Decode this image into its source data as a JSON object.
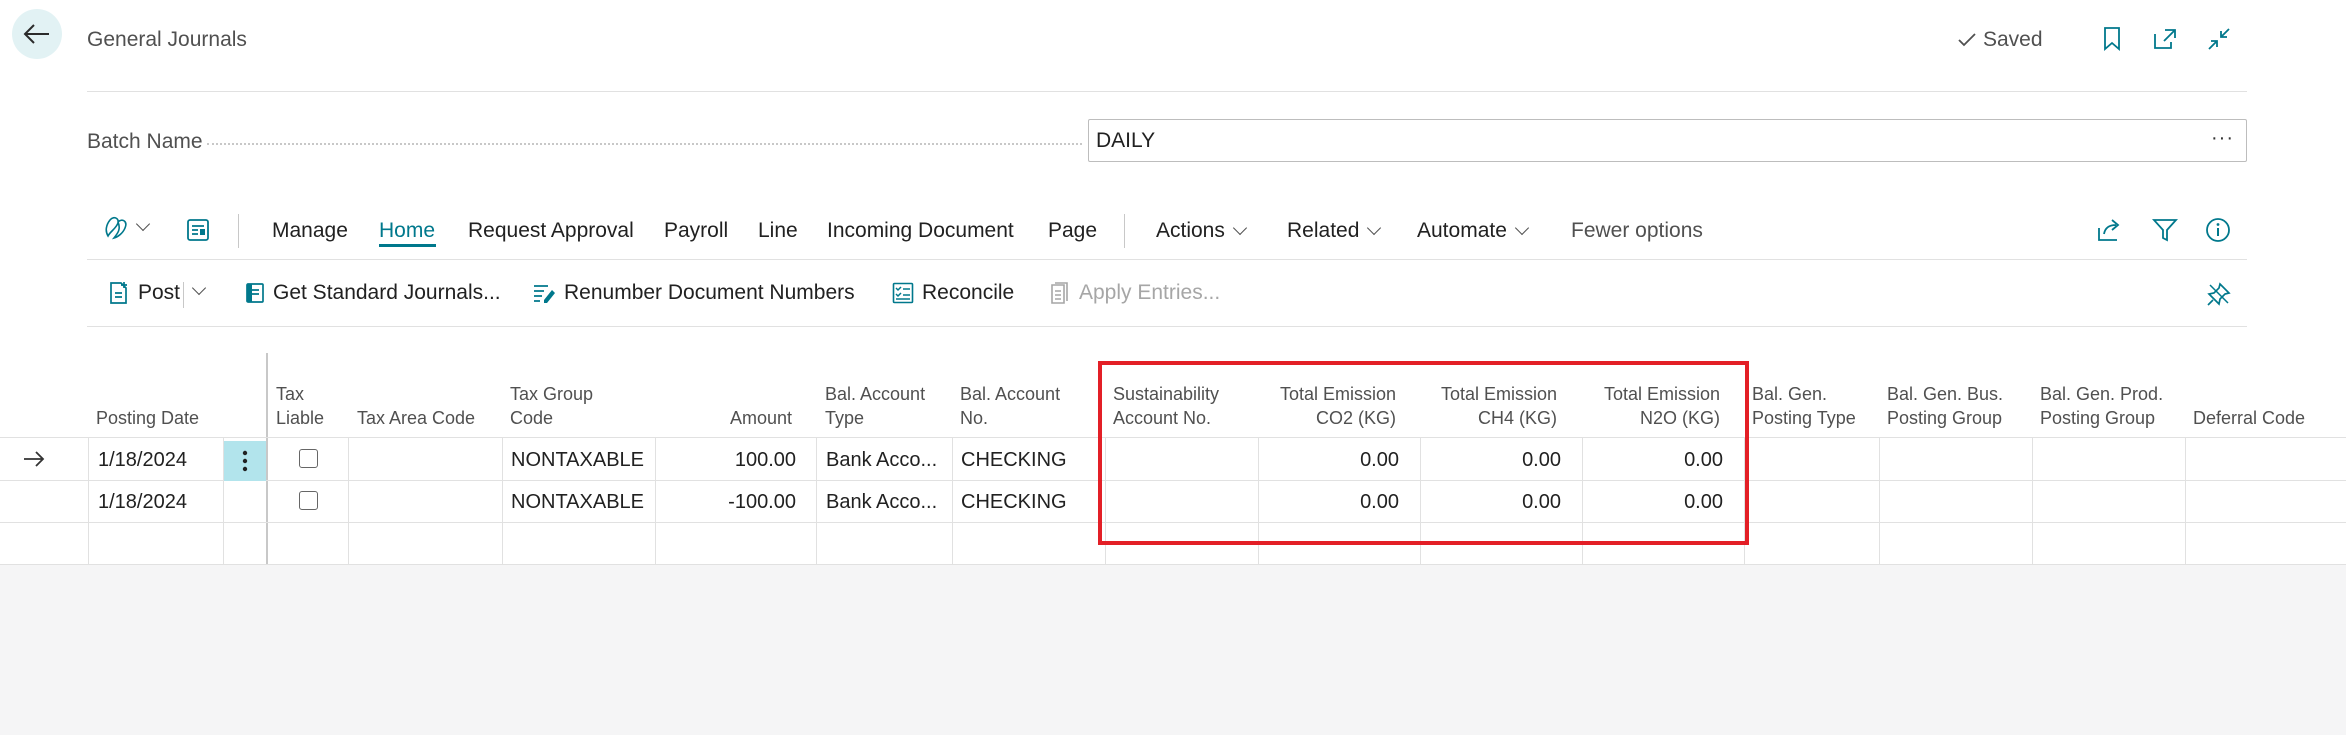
{
  "header": {
    "title": "General Journals",
    "saved_label": "Saved"
  },
  "batch": {
    "label": "Batch Name",
    "value": "DAILY"
  },
  "menu": {
    "items": [
      "Manage",
      "Home",
      "Request Approval",
      "Payroll",
      "Line",
      "Incoming Document",
      "Page"
    ],
    "active": "Home",
    "dropdowns": [
      "Actions",
      "Related",
      "Automate"
    ],
    "fewer_options": "Fewer options"
  },
  "commands": {
    "post": "Post",
    "get_standard": "Get Standard Journals...",
    "renumber": "Renumber Document Numbers",
    "reconcile": "Reconcile",
    "apply_entries": "Apply Entries..."
  },
  "table": {
    "columns": [
      {
        "line1": "",
        "line2": "Posting Date"
      },
      {
        "line1": "Tax",
        "line2": "Liable"
      },
      {
        "line1": "",
        "line2": "Tax Area Code"
      },
      {
        "line1": "Tax Group",
        "line2": "Code"
      },
      {
        "line1": "",
        "line2": "Amount"
      },
      {
        "line1": "Bal. Account",
        "line2": "Type"
      },
      {
        "line1": "Bal. Account",
        "line2": "No."
      },
      {
        "line1": "Sustainability",
        "line2": "Account No."
      },
      {
        "line1": "Total Emission",
        "line2": "CO2 (KG)"
      },
      {
        "line1": "Total Emission",
        "line2": "CH4 (KG)"
      },
      {
        "line1": "Total Emission",
        "line2": "N2O (KG)"
      },
      {
        "line1": "Bal. Gen.",
        "line2": "Posting Type"
      },
      {
        "line1": "Bal. Gen. Bus.",
        "line2": "Posting Group"
      },
      {
        "line1": "Bal. Gen. Prod.",
        "line2": "Posting Group"
      },
      {
        "line1": "",
        "line2": "Deferral Code"
      }
    ],
    "rows": [
      {
        "posting_date": "1/18/2024",
        "tax_group": "NONTAXABLE",
        "amount": "100.00",
        "bal_type": "Bank Acco...",
        "bal_no": "CHECKING",
        "co2": "0.00",
        "ch4": "0.00",
        "n2o": "0.00"
      },
      {
        "posting_date": "1/18/2024",
        "tax_group": "NONTAXABLE",
        "amount": "-100.00",
        "bal_type": "Bank Acco...",
        "bal_no": "CHECKING",
        "co2": "0.00",
        "ch4": "0.00",
        "n2o": "0.00"
      }
    ]
  },
  "colors": {
    "accent": "#00788c",
    "highlight": "#e31f26",
    "row_menu": "#b2e4ec"
  },
  "icons": [
    "back-arrow-icon",
    "checkmark-icon",
    "bookmark-icon",
    "open-new-window-icon",
    "collapse-icon",
    "copilot-icon",
    "edit-list-icon",
    "share-icon",
    "filter-icon",
    "info-icon",
    "post-icon",
    "journal-icon",
    "renumber-icon",
    "reconcile-icon",
    "apply-entries-icon",
    "pin-icon",
    "row-arrow-icon",
    "row-menu-icon"
  ]
}
